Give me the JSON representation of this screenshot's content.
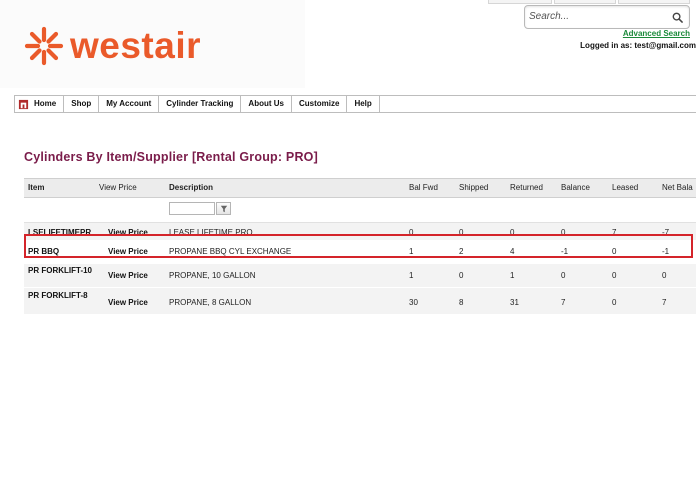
{
  "brand": {
    "name": "westair",
    "accent_color": "#ea5a2a"
  },
  "search": {
    "placeholder": "Search...",
    "advanced_label": "Advanced Search"
  },
  "user": {
    "logged_in_text": "Logged in as: test@gmail.com"
  },
  "nav": {
    "items": [
      {
        "label": "Home",
        "icon": "home-icon"
      },
      {
        "label": "Shop"
      },
      {
        "label": "My Account"
      },
      {
        "label": "Cylinder Tracking"
      },
      {
        "label": "About Us"
      },
      {
        "label": "Customize"
      },
      {
        "label": "Help"
      }
    ]
  },
  "page": {
    "title": "Cylinders By Item/Supplier [Rental Group: PRO]"
  },
  "table": {
    "columns": [
      "Item",
      "View Price",
      "Description",
      "Bal Fwd",
      "Shipped",
      "Returned",
      "Balance",
      "Leased",
      "Net Bala"
    ],
    "filter_icon": "funnel-icon",
    "rows": [
      {
        "item": "LSELIFETIMEPR",
        "view_price": "View Price",
        "description": "LEASE LIFETIME PRO",
        "bal_fwd": "0",
        "shipped": "0",
        "returned": "0",
        "balance": "0",
        "leased": "7",
        "net_balance": "-7",
        "highlighted": false
      },
      {
        "item": "PR BBQ",
        "view_price": "View Price",
        "description": "PROPANE BBQ CYL EXCHANGE",
        "bal_fwd": "1",
        "shipped": "2",
        "returned": "4",
        "balance": "-1",
        "leased": "0",
        "net_balance": "-1",
        "highlighted": true
      },
      {
        "item": "PR FORKLIFT-10",
        "view_price": "View Price",
        "description": "PROPANE, 10 GALLON",
        "bal_fwd": "1",
        "shipped": "0",
        "returned": "1",
        "balance": "0",
        "leased": "0",
        "net_balance": "0",
        "highlighted": false
      },
      {
        "item": "PR FORKLIFT-8",
        "view_price": "View Price",
        "description": "PROPANE, 8 GALLON",
        "bal_fwd": "30",
        "shipped": "8",
        "returned": "31",
        "balance": "7",
        "leased": "0",
        "net_balance": "7",
        "highlighted": false
      }
    ]
  },
  "colors": {
    "title": "#7a1c4a",
    "link_green": "#1a8a3a",
    "highlight_border": "#d4242a"
  }
}
